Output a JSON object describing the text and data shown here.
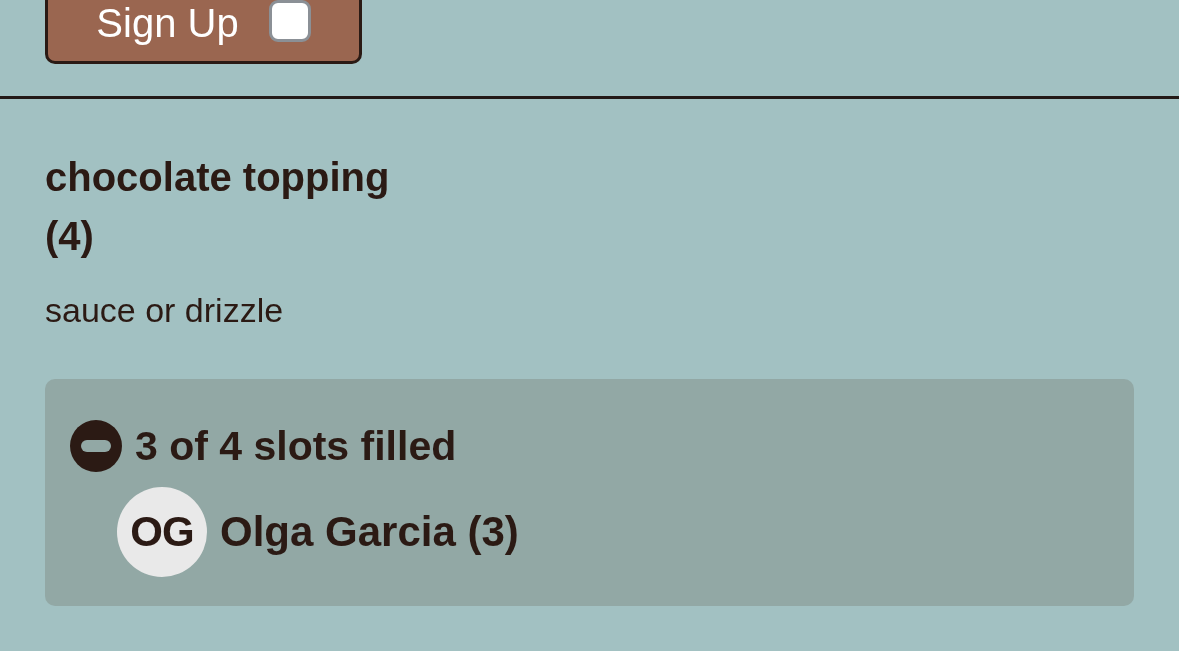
{
  "signup_button": {
    "label": "Sign Up",
    "checked": false
  },
  "item": {
    "title": "chocolate topping",
    "count": "(4)",
    "description": "sauce or drizzle",
    "slots": {
      "expanded": true,
      "summary": "3 of 4 slots filled",
      "signups": [
        {
          "initials": "OG",
          "name": "Olga Garcia (3)"
        }
      ]
    }
  }
}
